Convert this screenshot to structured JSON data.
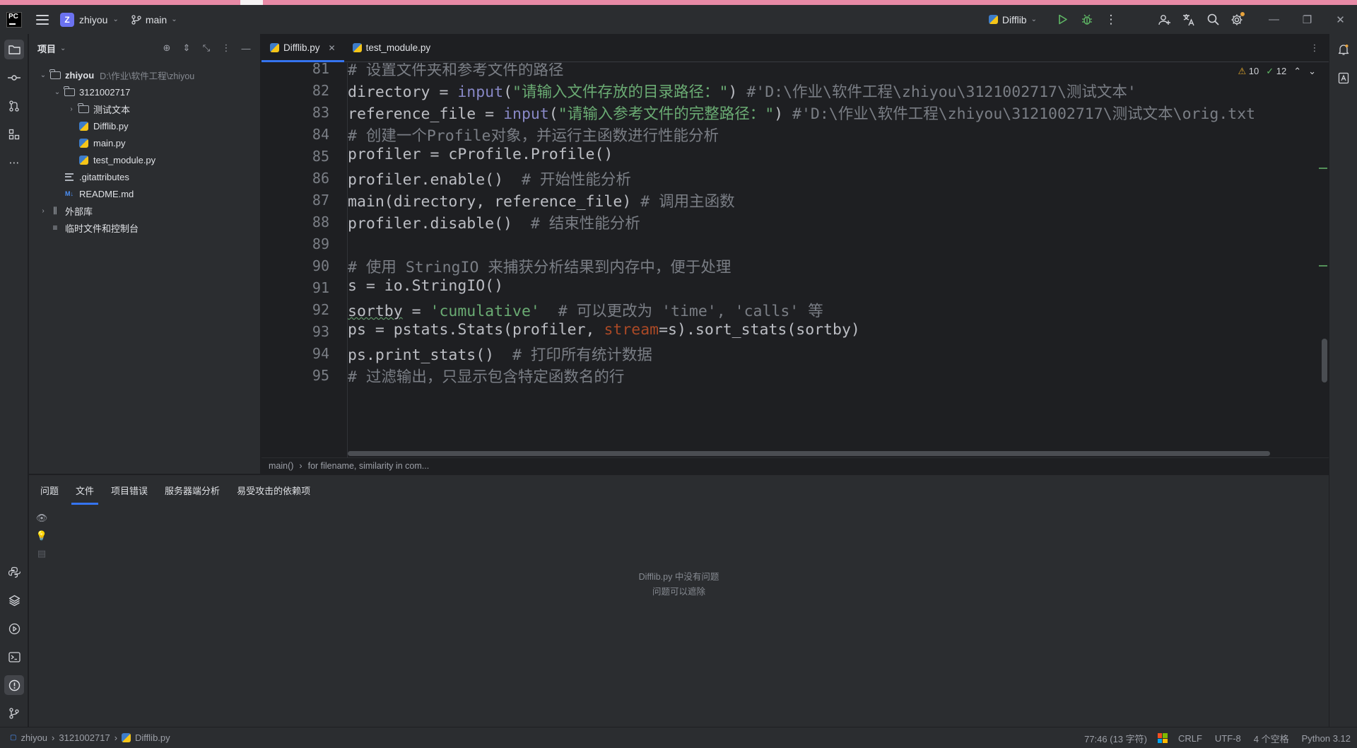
{
  "titlebar": {
    "app_logo": "PC",
    "project_badge": "Z",
    "project_name": "zhiyou",
    "branch": "main",
    "run_config": "Difflib"
  },
  "project_panel": {
    "title": "项目",
    "tree": [
      {
        "label": "zhiyou",
        "path": "D:\\作业\\软件工程\\zhiyou",
        "icon": "folder-icon",
        "depth": 0,
        "expanded": true,
        "bold": true
      },
      {
        "label": "3121002717",
        "icon": "folder-icon",
        "depth": 1,
        "expanded": true
      },
      {
        "label": "测试文本",
        "icon": "folder-icon",
        "depth": 2,
        "expanded": false
      },
      {
        "label": "Difflib.py",
        "icon": "python-file-icon",
        "depth": 2
      },
      {
        "label": "main.py",
        "icon": "python-file-icon",
        "depth": 2
      },
      {
        "label": "test_module.py",
        "icon": "python-file-icon",
        "depth": 2
      },
      {
        "label": ".gitattributes",
        "icon": "text-file-icon",
        "depth": 1
      },
      {
        "label": "README.md",
        "icon": "markdown-file-icon",
        "depth": 1
      },
      {
        "label": "外部库",
        "icon": "library-icon",
        "depth": 0,
        "expanded": false
      },
      {
        "label": "临时文件和控制台",
        "icon": "scratches-icon",
        "depth": 0
      }
    ]
  },
  "editor_tabs": [
    {
      "label": "Difflib.py",
      "active": true,
      "closable": true
    },
    {
      "label": "test_module.py",
      "active": false
    }
  ],
  "inspections": {
    "warnings": "10",
    "weak_warnings": "12"
  },
  "code": {
    "lines": [
      {
        "n": "81",
        "text": "# 设置文件夹和参考文件的路径"
      },
      {
        "n": "82",
        "text": "directory = input(\"请输入文件存放的目录路径：\") #'D:\\作业\\软件工程\\zhiyou\\3121002717\\测试文本'"
      },
      {
        "n": "83",
        "text": "reference_file = input(\"请输入参考文件的完整路径：\") #'D:\\作业\\软件工程\\zhiyou\\3121002717\\测试文本\\orig.txt"
      },
      {
        "n": "84",
        "text": "# 创建一个Profile对象，并运行主函数进行性能分析"
      },
      {
        "n": "85",
        "text": "profiler = cProfile.Profile()"
      },
      {
        "n": "86",
        "text": "profiler.enable()  # 开始性能分析"
      },
      {
        "n": "87",
        "text": "main(directory, reference_file) # 调用主函数"
      },
      {
        "n": "88",
        "text": "profiler.disable()  # 结束性能分析"
      },
      {
        "n": "89",
        "text": ""
      },
      {
        "n": "90",
        "text": "# 使用 StringIO 来捕获分析结果到内存中，便于处理"
      },
      {
        "n": "91",
        "text": "s = io.StringIO()"
      },
      {
        "n": "92",
        "text": "sortby = 'cumulative'  # 可以更改为 'time', 'calls' 等"
      },
      {
        "n": "93",
        "text": "ps = pstats.Stats(profiler, stream=s).sort_stats(sortby)"
      },
      {
        "n": "94",
        "text": "ps.print_stats()  # 打印所有统计数据"
      },
      {
        "n": "95",
        "text": "# 过滤输出，只显示包含特定函数名的行"
      }
    ]
  },
  "breadcrumbs": [
    "main()",
    "for filename, similarity in com..."
  ],
  "bottom_panel": {
    "tabs": [
      {
        "label": "问题",
        "active": false
      },
      {
        "label": "文件",
        "active": true
      },
      {
        "label": "项目错误",
        "active": false
      },
      {
        "label": "服务器端分析",
        "active": false
      },
      {
        "label": "易受攻击的依赖项",
        "active": false
      }
    ],
    "empty_line1": "Difflib.py 中没有问题",
    "empty_line2": "问题可以遮除"
  },
  "statusbar": {
    "path": [
      "zhiyou",
      "3121002717",
      "Difflib.py"
    ],
    "position": "77:46 (13 字符)",
    "line_sep": "CRLF",
    "encoding": "UTF-8",
    "indent": "4 个空格",
    "interpreter": "Python 3.12"
  },
  "colors": {
    "accent": "#3574f0",
    "comment": "#7a7e85",
    "string": "#6aab73",
    "builtin": "#8888c6"
  }
}
